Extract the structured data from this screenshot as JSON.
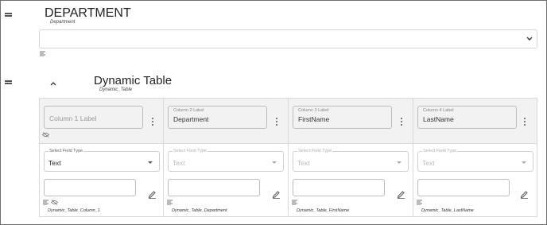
{
  "department_section": {
    "title": "DEPARTMENT",
    "field_name": "Department",
    "select_value": ""
  },
  "dynamic_table_section": {
    "title": "Dynamic Table",
    "field_name": "Dynamic_Table"
  },
  "columns": [
    {
      "label_floating": "",
      "label_value": "",
      "label_placeholder": "Column 1 Label",
      "select_floating": "Select Field Type",
      "select_value": "Text",
      "select_enabled": true,
      "field_name": "Dynamic_Table_Column_1"
    },
    {
      "label_floating": "Column 2 Label",
      "label_value": "Department",
      "label_placeholder": "",
      "select_floating": "Select Field Type",
      "select_value": "Text",
      "select_enabled": false,
      "field_name": "Dynamic_Table_Department"
    },
    {
      "label_floating": "Column 3 Label",
      "label_value": "FirstName",
      "label_placeholder": "",
      "select_floating": "Select Field Type",
      "select_value": "Text",
      "select_enabled": false,
      "field_name": "Dynamic_Table_FirstName"
    },
    {
      "label_floating": "Column 4 Label",
      "label_value": "LastName",
      "label_placeholder": "",
      "select_floating": "Select Field Type",
      "select_value": "Text",
      "select_enabled": false,
      "field_name": "Dynamic_Table_LastName"
    }
  ],
  "icons": {
    "drag": "drag-handle-icon",
    "chevron": "chevron-down-icon",
    "collapse": "chevron-up-icon",
    "lines": "text-lines-icon",
    "hide": "eye-off-icon",
    "kebab": "more-vert-icon",
    "edit": "pencil-icon"
  },
  "colors": {
    "header_bg": "#f2f2f2",
    "border": "#d9d9d9",
    "text": "#333333"
  }
}
